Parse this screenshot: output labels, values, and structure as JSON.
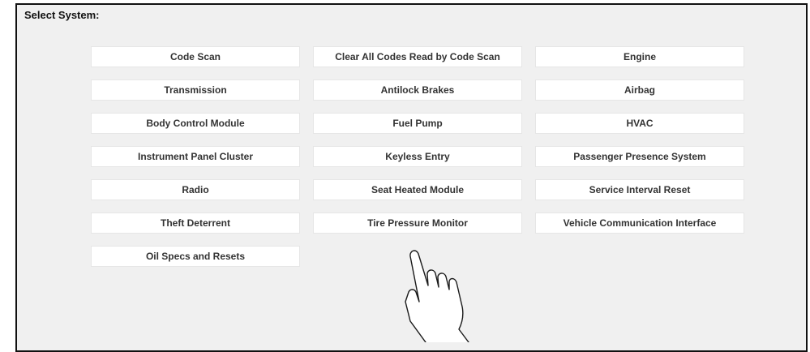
{
  "panel": {
    "title": "Select System:"
  },
  "systems": [
    "Code Scan",
    "Clear All Codes Read by Code Scan",
    "Engine",
    "Transmission",
    "Antilock Brakes",
    "Airbag",
    "Body Control Module",
    "Fuel Pump",
    "HVAC",
    "Instrument Panel Cluster",
    "Keyless Entry",
    "Passenger Presence System",
    "Radio",
    "Seat Heated Module",
    "Service Interval Reset",
    "Theft Deterrent",
    "Tire Pressure Monitor",
    "Vehicle Communication Interface",
    "Oil Specs and Resets"
  ],
  "pointer": {
    "icon": "hand-pointer-icon",
    "target": "Tire Pressure Monitor"
  }
}
